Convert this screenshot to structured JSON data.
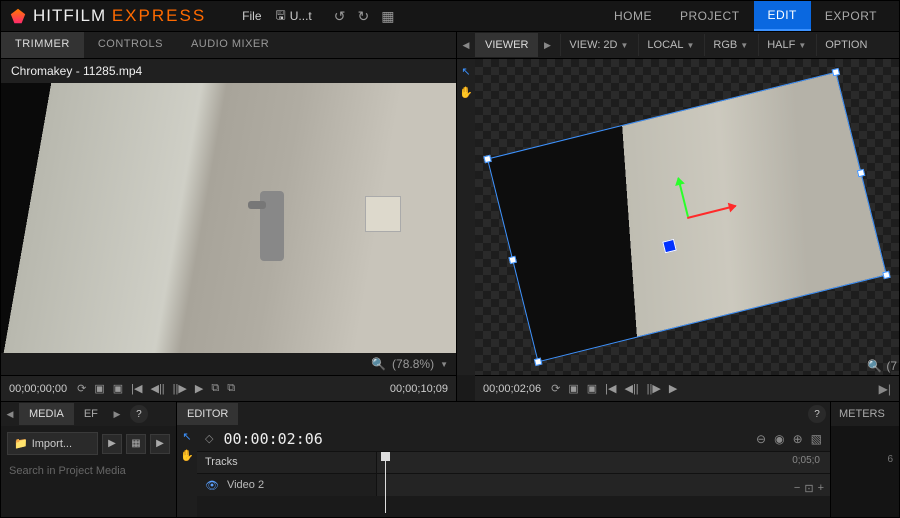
{
  "brand": {
    "word1": "HITFILM",
    "word2": "EXPRESS"
  },
  "menu": {
    "file": "File",
    "save_label": "U...t"
  },
  "main_tabs": [
    "HOME",
    "PROJECT",
    "EDIT",
    "EXPORT"
  ],
  "main_tab_active": 2,
  "left_tabs": [
    "TRIMMER",
    "CONTROLS",
    "AUDIO MIXER"
  ],
  "left_tab_active": 0,
  "clip_name": "Chromakey - 11285.mp4",
  "trimmer": {
    "zoom": "(78.8%)",
    "tc_left": "00;00;00;00",
    "tc_right": "00;00;10;09"
  },
  "viewer_tab": "VIEWER",
  "viewer_options": {
    "view": "VIEW: 2D",
    "space": "LOCAL",
    "channels": "RGB",
    "quality": "HALF",
    "options": "OPTION"
  },
  "viewer": {
    "zoom_prefix": "(7",
    "tc": "00;00;02;06"
  },
  "media_panel": {
    "tab": "MEDIA",
    "tab2": "EF",
    "import": "Import...",
    "search": "Search in Project Media"
  },
  "editor": {
    "tab": "EDITOR",
    "tc": "00:00:02:06",
    "tracks_label": "Tracks",
    "ruler_tc": "0;05;0",
    "track1": "Video 2"
  },
  "meters": {
    "tab": "METERS",
    "value": "6"
  }
}
